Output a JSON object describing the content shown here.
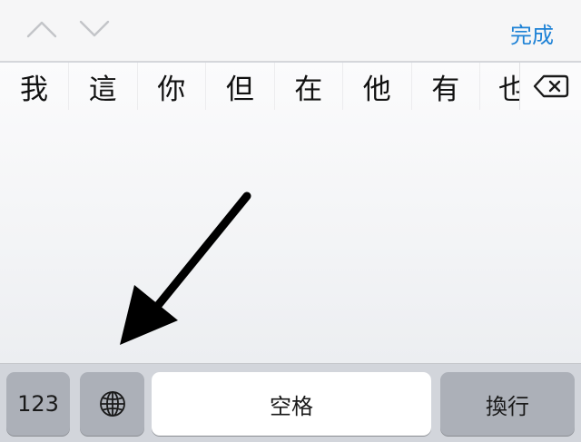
{
  "accessory_bar": {
    "up_arrow_icon": "chevron-up-icon",
    "down_arrow_icon": "chevron-down-icon",
    "done_label": "完成",
    "done_color": "#1e82d6"
  },
  "candidates": [
    "我",
    "這",
    "你",
    "但",
    "在",
    "他",
    "有",
    "也"
  ],
  "delete_icon": "backspace-icon",
  "annotation_icon": "arrow-pointer-icon",
  "keys": {
    "numbers_label": "123",
    "globe_icon": "globe-icon",
    "space_label": "空格",
    "return_label": "換行"
  }
}
